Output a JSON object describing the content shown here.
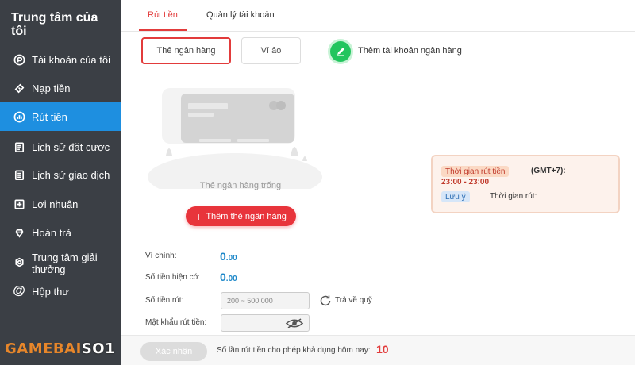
{
  "sidebar": {
    "title": "Trung tâm của tôi",
    "items": [
      {
        "label": "Tài khoản của tôi",
        "icon": "account-icon"
      },
      {
        "label": "Nạp tiền",
        "icon": "deposit-icon"
      },
      {
        "label": "Rút tiền",
        "icon": "withdraw-icon",
        "active": true
      },
      {
        "label": "Lịch sử đặt cược",
        "icon": "bet-history-icon"
      },
      {
        "label": "Lịch sử giao dịch",
        "icon": "transaction-history-icon"
      },
      {
        "label": "Lợi nhuận",
        "icon": "profit-icon"
      },
      {
        "label": "Hoàn trả",
        "icon": "rebate-icon"
      },
      {
        "label": "Trung tâm giải thưởng",
        "icon": "reward-center-icon"
      },
      {
        "label": "Hộp thư",
        "icon": "mailbox-icon"
      }
    ]
  },
  "tabs": [
    {
      "label": "Rút tiền",
      "active": true
    },
    {
      "label": "Quản lý tài khoản",
      "active": false
    }
  ],
  "account_type": {
    "bank_card": "Thẻ ngân hàng",
    "e_wallet": "Ví ảo",
    "selected": "bank_card"
  },
  "add_account_label": "Thêm tài khoản ngân hàng",
  "empty_state": {
    "text": "Thẻ ngân hàng trống",
    "button_label": "Thêm thẻ ngân hàng"
  },
  "withdraw_info": {
    "time_tag": "Thời gian rút tiền",
    "timezone": "(GMT+7):",
    "time_range": "23:00 - 23:00",
    "note_tag": "Lưu ý",
    "note_text": "Thời gian rút:"
  },
  "form": {
    "main_wallet_label": "Ví chính:",
    "main_wallet_int": "0",
    "main_wallet_dec": ".00",
    "current_amount_label": "Số tiền hiện có:",
    "current_amount_int": "0",
    "current_amount_dec": ".00",
    "withdraw_amount_label": "Số tiền rút:",
    "withdraw_amount_placeholder": "200 ~ 500,000",
    "return_to_wallet_label": "Trả về quỹ",
    "password_label": "Mật khẩu rút tiền:"
  },
  "footer": {
    "confirm_label": "Xác nhận",
    "limit_label": "Số lần rút tiền cho phép khả dụng hôm nay:",
    "limit_value": "10"
  },
  "logo": {
    "part1": "GAMEBAI",
    "part2": "SO1"
  },
  "colors": {
    "accent_red": "#e23b3b",
    "active_blue": "#1e8fe0",
    "sidebar_bg": "#3b3f45",
    "balance_blue": "#1e88c9",
    "green": "#22c55e"
  }
}
